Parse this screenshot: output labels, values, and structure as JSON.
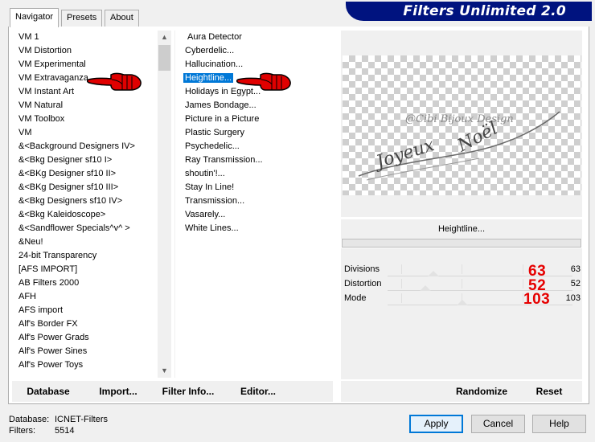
{
  "app": {
    "title": "Filters Unlimited 2.0",
    "banner_color": "#00137f",
    "selection_color": "#0078d7",
    "annotation_color": "#e60000"
  },
  "tabs": [
    {
      "label": "Navigator",
      "active": true
    },
    {
      "label": "Presets",
      "active": false
    },
    {
      "label": "About",
      "active": false
    }
  ],
  "categories": [
    "VM 1",
    "VM Distortion",
    "VM Experimental",
    "VM Extravaganza",
    "VM Instant Art",
    "VM Natural",
    "VM Toolbox",
    "VM",
    "&<Background Designers IV>",
    "&<Bkg Designer sf10 I>",
    "&<BKg Designer sf10 II>",
    "&<BKg Designer sf10 III>",
    "&<Bkg Designers sf10 IV>",
    "&<Bkg Kaleidoscope>",
    "&<Sandflower Specials^v^ >",
    "&Neu!",
    "24-bit Transparency",
    "[AFS IMPORT]",
    "AB Filters 2000",
    "AFH",
    "AFS import",
    "Alf's Border FX",
    "Alf's Power Grads",
    "Alf's Power Sines",
    "Alf's Power Toys"
  ],
  "selected_category": "VM Extravaganza",
  "filters": [
    "Aura Detector",
    "Cyberdelic...",
    "Hallucination...",
    "Heightline...",
    "Holidays in Egypt...",
    "James Bondage...",
    "Picture in a Picture",
    "Plastic Surgery",
    "Psychedelic...",
    "Ray Transmission...",
    "shoutin'!...",
    "Stay In Line!",
    "Transmission...",
    "Vasarely...",
    "White Lines..."
  ],
  "selected_filter": "Heightline...",
  "preview": {
    "watermark": "@Cibi Bijoux Design",
    "text_line1": "Joyeux",
    "text_line2": "Noël"
  },
  "current_filter_name": "Heightline...",
  "params": [
    {
      "label": "Divisions",
      "value": "63",
      "annotation": "63",
      "level": 0.247
    },
    {
      "label": "Distortion",
      "value": "52",
      "annotation": "52",
      "level": 0.204
    },
    {
      "label": "Mode",
      "value": "103",
      "annotation": "103",
      "level": 0.404
    }
  ],
  "toolbar": {
    "database": "Database",
    "import": "Import...",
    "filter_info": "Filter Info...",
    "editor": "Editor...",
    "randomize": "Randomize",
    "reset": "Reset"
  },
  "footer": {
    "database_label": "Database:",
    "database_value": "ICNET-Filters",
    "filters_label": "Filters:",
    "filters_value": "5514"
  },
  "dialog_buttons": {
    "apply": "Apply",
    "cancel": "Cancel",
    "help": "Help"
  },
  "icons": [
    "pointing-hand-icon",
    "scroll-up-arrow-icon",
    "scroll-down-arrow-icon"
  ]
}
